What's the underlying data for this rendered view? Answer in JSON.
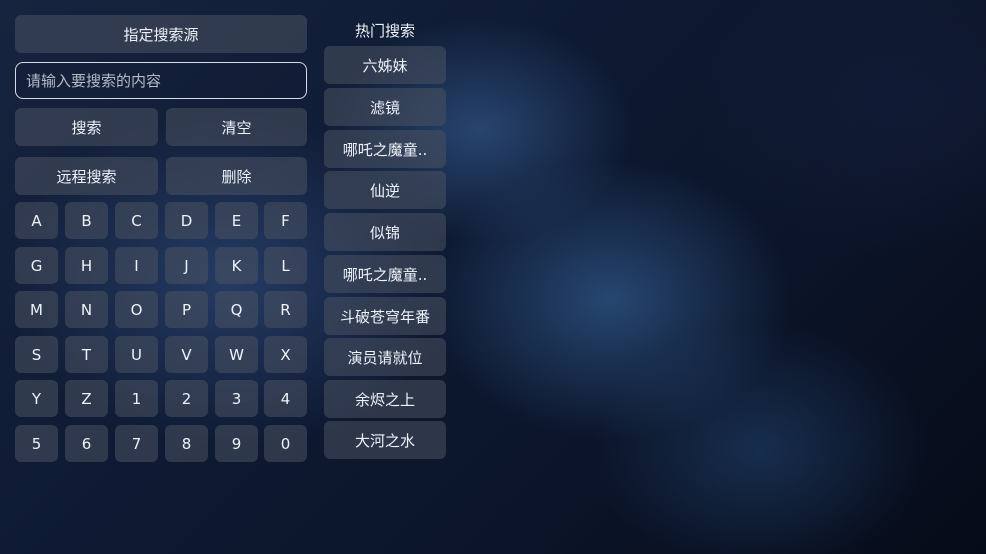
{
  "controls": {
    "source_label": "指定搜索源",
    "search_placeholder": "请输入要搜索的内容",
    "search_label": "搜索",
    "clear_label": "清空",
    "remote_search_label": "远程搜索",
    "delete_label": "删除"
  },
  "keyboard": {
    "keys": [
      "A",
      "B",
      "C",
      "D",
      "E",
      "F",
      "G",
      "H",
      "I",
      "J",
      "K",
      "L",
      "M",
      "N",
      "O",
      "P",
      "Q",
      "R",
      "S",
      "T",
      "U",
      "V",
      "W",
      "X",
      "Y",
      "Z",
      "1",
      "2",
      "3",
      "4",
      "5",
      "6",
      "7",
      "8",
      "9",
      "0"
    ]
  },
  "hot": {
    "title": "热门搜索",
    "items": [
      "六姊妹",
      "滤镜",
      "哪吒之魔童..",
      "仙逆",
      "似锦",
      "哪吒之魔童..",
      "斗破苍穹年番",
      "演员请就位",
      "余烬之上",
      "大河之水"
    ]
  }
}
